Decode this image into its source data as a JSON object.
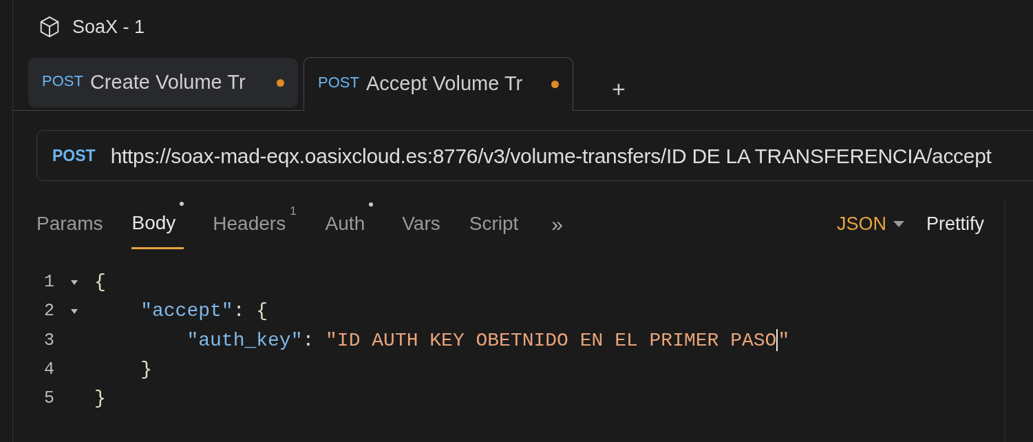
{
  "collection": {
    "title": "SoaX - 1"
  },
  "tabs": [
    {
      "method": "POST",
      "label": "Create Volume Tr",
      "modified": true,
      "selected": false
    },
    {
      "method": "POST",
      "label": "Accept Volume Tr",
      "modified": true,
      "selected": true
    }
  ],
  "new_tab": "+",
  "request": {
    "method": "POST",
    "url": "https://soax-mad-eqx.oasixcloud.es:8776/v3/volume-transfers/ID DE LA TRANSFERENCIA/accept"
  },
  "request_tabs": [
    {
      "label": "Params",
      "selected": false
    },
    {
      "label": "Body",
      "selected": true,
      "modified": true
    },
    {
      "label": "Headers",
      "selected": false,
      "count": "1"
    },
    {
      "label": "Auth",
      "selected": false,
      "modified": true
    },
    {
      "label": "Vars",
      "selected": false
    },
    {
      "label": "Script",
      "selected": false
    }
  ],
  "more": "»",
  "body_mode": "JSON",
  "prettify": "Prettify",
  "code": [
    {
      "number": "1",
      "foldable": true,
      "tokens": [
        {
          "kind": "punct",
          "text": "{"
        }
      ]
    },
    {
      "number": "2",
      "foldable": true,
      "tokens": [
        {
          "kind": "key",
          "text": "    \"accept\""
        },
        {
          "kind": "punct",
          "text": ": {"
        }
      ]
    },
    {
      "number": "3",
      "foldable": false,
      "tokens": [
        {
          "kind": "key",
          "text": "        \"auth_key\""
        },
        {
          "kind": "punct",
          "text": ": "
        },
        {
          "kind": "string",
          "text": "\"ID AUTH KEY OBETNIDO EN EL PRIMER PASO",
          "cursor_after": true
        },
        {
          "kind": "string",
          "text": "\""
        }
      ]
    },
    {
      "number": "4",
      "foldable": false,
      "tokens": [
        {
          "kind": "punct",
          "text": "    }"
        }
      ]
    },
    {
      "number": "5",
      "foldable": false,
      "tokens": [
        {
          "kind": "punct",
          "text": "}"
        }
      ]
    }
  ]
}
